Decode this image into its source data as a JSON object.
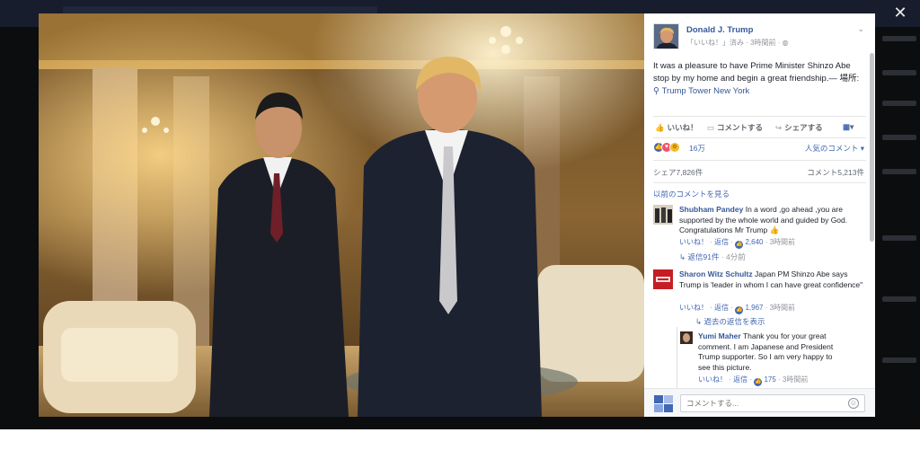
{
  "theater": {
    "close_icon": "close-icon",
    "close_glyph": "✕"
  },
  "post": {
    "author": "Donald J. Trump",
    "meta": "「いいね！」済み · 3時間前 · ",
    "globe_icon": "globe-icon",
    "text": "It was a pleasure to have Prime Minister Shinzo Abe stop by my home and begin a great friendship.",
    "location_sep": "— 場所: ",
    "location": "Trump Tower New York"
  },
  "actions": {
    "like": "いいね！",
    "comment": "コメントする",
    "share": "シェアする"
  },
  "reactions": {
    "count": "16万",
    "sort": "人気のコメント"
  },
  "stats": {
    "shares": "シェア7,826件",
    "comments": "コメント5,213件"
  },
  "previous_comments": "以前のコメントを見る",
  "comments": [
    {
      "author": "Shubham Pandey",
      "text": "In a word ,go ahead ,you are supported by the whole world and guided by God. Congratulations Mr Trump",
      "like": "いいね！",
      "reply": "返信",
      "likes": "2,640",
      "time": "3時間前",
      "replies": "返信91件",
      "replies_time": "4分前"
    },
    {
      "author": "Sharon Witz Schultz",
      "text": "Japan PM Shinzo Abe says Trump is 'leader in whom I can have great confidence\"",
      "like": "いいね！",
      "reply": "返信",
      "likes": "1,967",
      "time": "3時間前",
      "replies": "過去の返信を表示"
    }
  ],
  "reply": {
    "author": "Yumi Maher",
    "text": "Thank you for your great comment. I am Japanese and President Trump supporter. So I am very happy to see this picture.",
    "like": "いいね！",
    "reply": "返信",
    "likes": "175",
    "time": "3時間前"
  },
  "composer": {
    "placeholder": "コメントする..."
  },
  "colors": {
    "link": "#365899",
    "accent": "#4267b2",
    "heart": "#f25268",
    "wow": "#f7b928"
  }
}
